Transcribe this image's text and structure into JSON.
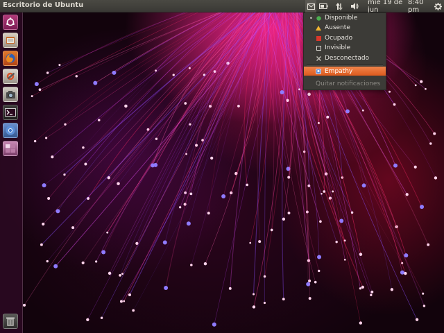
{
  "panel": {
    "title": "Escritorio de Ubuntu",
    "date": "mié 19 de jun",
    "time": "8:40 pm"
  },
  "tray_icons": [
    "mail-icon",
    "battery-icon",
    "network-icon",
    "volume-icon",
    "gear-icon"
  ],
  "status_menu": {
    "items": [
      {
        "label": "Disponible",
        "icon": "available-dot-icon",
        "selected": true
      },
      {
        "label": "Ausente",
        "icon": "away-triangle-icon",
        "selected": false
      },
      {
        "label": "Ocupado",
        "icon": "busy-square-icon",
        "selected": false
      },
      {
        "label": "Invisible",
        "icon": "invisible-square-icon",
        "selected": false
      },
      {
        "label": "Desconectado",
        "icon": "offline-x-icon",
        "selected": false
      }
    ],
    "selected_bullet": "•",
    "app": {
      "label": "Empathy",
      "icon": "empathy-icon",
      "highlighted": true
    },
    "footer": "Quitar notificaciones"
  },
  "launcher": {
    "items": [
      {
        "name": "dash-home-icon"
      },
      {
        "name": "files-icon"
      },
      {
        "name": "firefox-icon"
      },
      {
        "name": "system-settings-icon"
      },
      {
        "name": "camera-icon"
      },
      {
        "name": "terminal-icon"
      },
      {
        "name": "chromium-icon"
      },
      {
        "name": "workspace-switcher-icon"
      },
      {
        "name": "trash-icon"
      }
    ]
  },
  "colors": {
    "panel_bg": "#3c3b37",
    "menu_highlight": "#dd4814",
    "available": "#4caf50",
    "away": "#f2b632",
    "busy": "#d9372b"
  }
}
